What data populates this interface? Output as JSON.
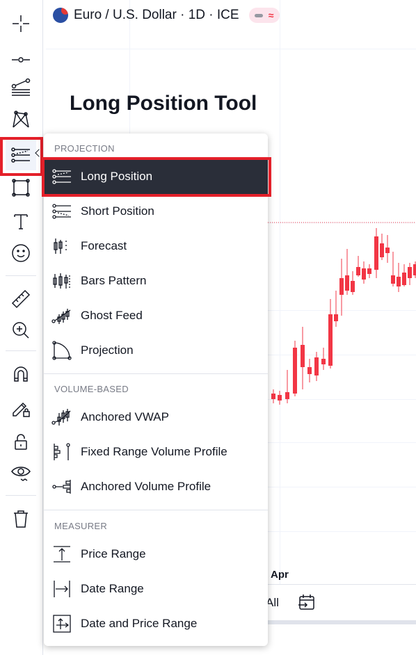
{
  "chart": {
    "symbol_title": "Euro / U.S. Dollar · 1D · ICE",
    "status_wave": "≈",
    "annotation": "Long Position Tool",
    "month_label": "Apr",
    "range_all": "All"
  },
  "toolbar": {
    "icons": [
      "crosshair-icon",
      "trend-line-icon",
      "fib-retracement-icon",
      "xabcd-pattern-icon",
      "projection-tools-icon",
      "rectangle-icon",
      "text-icon",
      "emoji-icon",
      "ruler-icon",
      "zoom-in-icon",
      "magnet-icon",
      "lock-drawing-icon",
      "lock-all-icon",
      "hide-icon",
      "trash-icon"
    ]
  },
  "menu": {
    "sections": [
      {
        "label": "PROJECTION",
        "items": [
          {
            "label": "Long Position",
            "icon": "long-position-icon",
            "selected": true
          },
          {
            "label": "Short Position",
            "icon": "short-position-icon"
          },
          {
            "label": "Forecast",
            "icon": "forecast-icon"
          },
          {
            "label": "Bars Pattern",
            "icon": "bars-pattern-icon"
          },
          {
            "label": "Ghost Feed",
            "icon": "ghost-feed-icon"
          },
          {
            "label": "Projection",
            "icon": "projection-icon"
          }
        ]
      },
      {
        "label": "VOLUME-BASED",
        "items": [
          {
            "label": "Anchored VWAP",
            "icon": "anchored-vwap-icon"
          },
          {
            "label": "Fixed Range Volume Profile",
            "icon": "fixed-range-volume-profile-icon"
          },
          {
            "label": "Anchored Volume Profile",
            "icon": "anchored-volume-profile-icon"
          }
        ]
      },
      {
        "label": "MEASURER",
        "items": [
          {
            "label": "Price Range",
            "icon": "price-range-icon"
          },
          {
            "label": "Date Range",
            "icon": "date-range-icon"
          },
          {
            "label": "Date and Price Range",
            "icon": "date-and-price-range-icon"
          }
        ]
      }
    ]
  },
  "colors": {
    "up": "#089981",
    "down": "#f23645",
    "highlight": "#e4202a",
    "selected_bg": "#2a2e39"
  }
}
